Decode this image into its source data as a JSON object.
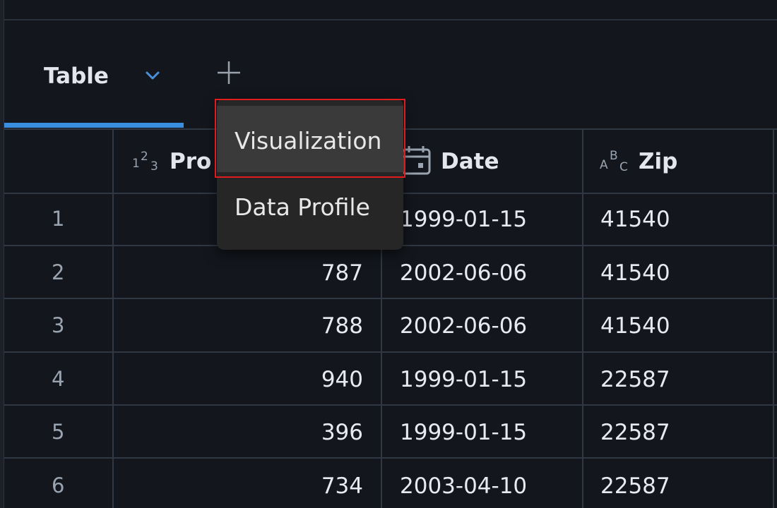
{
  "tabs": {
    "active_label": "Table",
    "add_icon": "plus-icon",
    "chevron_icon": "chevron-down-icon"
  },
  "colors": {
    "accent": "#3a8ee0",
    "highlight": "#e01c1c"
  },
  "columns": [
    {
      "type_icon": "number-type-icon",
      "label": "Pro"
    },
    {
      "type_icon": "calendar-icon",
      "label": "Date"
    },
    {
      "type_icon": "text-type-icon",
      "label": "Zip"
    }
  ],
  "rows": [
    {
      "num": "1",
      "product": "",
      "date": "1999-01-15",
      "zip": "41540"
    },
    {
      "num": "2",
      "product": "787",
      "date": "2002-06-06",
      "zip": "41540"
    },
    {
      "num": "3",
      "product": "788",
      "date": "2002-06-06",
      "zip": "41540"
    },
    {
      "num": "4",
      "product": "940",
      "date": "1999-01-15",
      "zip": "22587"
    },
    {
      "num": "5",
      "product": "396",
      "date": "1999-01-15",
      "zip": "22587"
    },
    {
      "num": "6",
      "product": "734",
      "date": "2003-04-10",
      "zip": "22587"
    }
  ],
  "menu": {
    "items": [
      "Visualization",
      "Data Profile"
    ]
  }
}
